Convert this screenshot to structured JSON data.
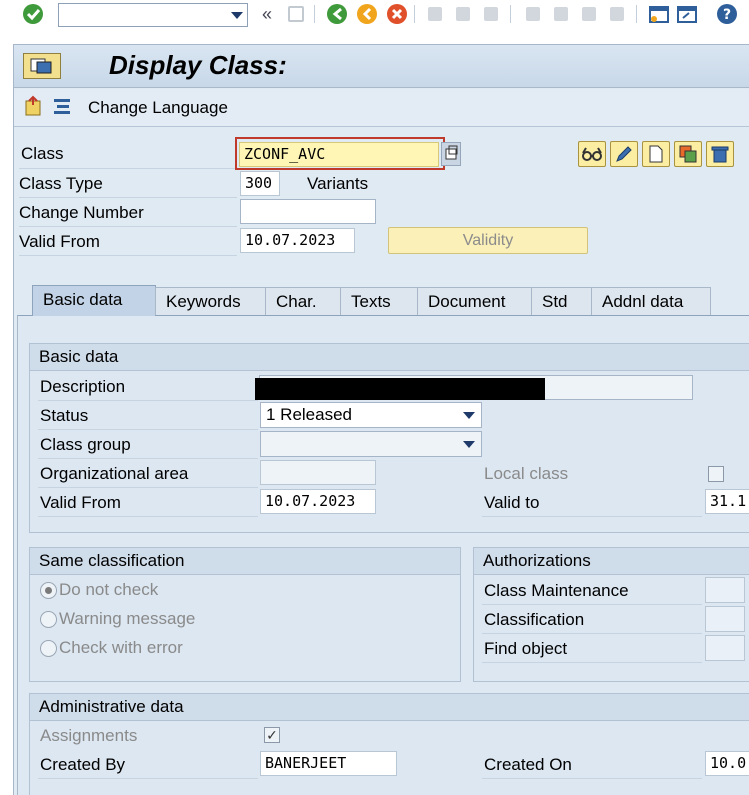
{
  "window": {
    "title": "Display Class:"
  },
  "app_toolbar": {
    "change_language": "Change Language"
  },
  "header": {
    "class_label": "Class",
    "class_value": "ZCONF_AVC",
    "class_type_label": "Class Type",
    "class_type_value": "300",
    "class_type_text": "Variants",
    "change_number_label": "Change Number",
    "change_number_value": "",
    "valid_from_label": "Valid From",
    "valid_from_value": "10.07.2023",
    "validity_button": "Validity"
  },
  "tabs": [
    "Basic data",
    "Keywords",
    "Char.",
    "Texts",
    "Document",
    "Std",
    "Addnl data"
  ],
  "basic_data": {
    "heading": "Basic data",
    "description_label": "Description",
    "status_label": "Status",
    "status_value": "1 Released",
    "class_group_label": "Class group",
    "class_group_value": "",
    "org_area_label": "Organizational area",
    "local_class_label": "Local class",
    "valid_from_label": "Valid From",
    "valid_from_value": "10.07.2023",
    "valid_to_label": "Valid to",
    "valid_to_value": "31.1"
  },
  "same_classification": {
    "heading": "Same classification",
    "option_1": "Do not check",
    "option_2": "Warning message",
    "option_3": "Check with error"
  },
  "authorizations": {
    "heading": "Authorizations",
    "class_maintenance": "Class Maintenance",
    "classification": "Classification",
    "find_object": "Find object"
  },
  "admin_data": {
    "heading": "Administrative data",
    "assignments_label": "Assignments",
    "created_by_label": "Created By",
    "created_by_value": "BANERJEET",
    "created_on_label": "Created On",
    "created_on_value": "10.0"
  },
  "colors": {
    "accent": "#fbeea2",
    "focus": "#c03a2b",
    "panel": "#dde8f3"
  }
}
